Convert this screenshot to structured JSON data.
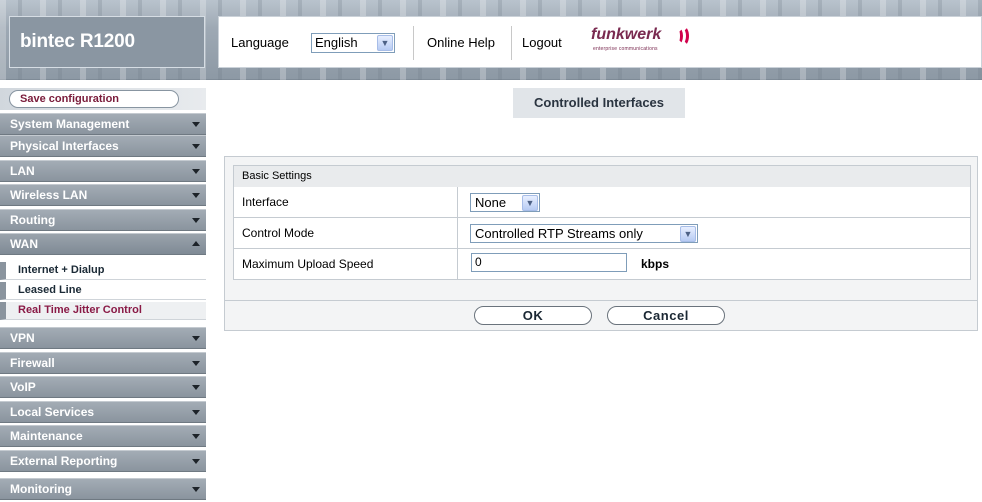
{
  "header": {
    "brand": "bintec R1200",
    "language_label": "Language",
    "language_value": "English",
    "help_label": "Online Help",
    "logout_label": "Logout",
    "logo_word": "funkwerk",
    "logo_tag": "enterprise communications"
  },
  "sidebar": {
    "save_label": "Save configuration",
    "items": [
      {
        "label": "System Management",
        "state": "collapsed"
      },
      {
        "label": "Physical Interfaces",
        "state": "collapsed"
      },
      {
        "label": "LAN",
        "state": "collapsed"
      },
      {
        "label": "Wireless LAN",
        "state": "collapsed"
      },
      {
        "label": "Routing",
        "state": "collapsed"
      },
      {
        "label": "WAN",
        "state": "expanded"
      },
      {
        "label": "VPN",
        "state": "collapsed"
      },
      {
        "label": "Firewall",
        "state": "collapsed"
      },
      {
        "label": "VoIP",
        "state": "collapsed"
      },
      {
        "label": "Local Services",
        "state": "collapsed"
      },
      {
        "label": "Maintenance",
        "state": "collapsed"
      },
      {
        "label": "External Reporting",
        "state": "collapsed"
      },
      {
        "label": "Monitoring",
        "state": "collapsed"
      }
    ],
    "wan_subitems": [
      {
        "label": "Internet + Dialup",
        "active": false
      },
      {
        "label": "Leased Line",
        "active": false
      },
      {
        "label": "Real Time Jitter Control",
        "active": true
      }
    ]
  },
  "main": {
    "page_title": "Controlled Interfaces",
    "section_title": "Basic Settings",
    "fields": {
      "interface_label": "Interface",
      "interface_value": "None",
      "control_mode_label": "Control Mode",
      "control_mode_value": "Controlled RTP Streams only",
      "upload_label": "Maximum Upload Speed",
      "upload_value": "0",
      "upload_unit": "kbps"
    },
    "ok_label": "OK",
    "cancel_label": "Cancel"
  },
  "colors": {
    "active_subitem": "#8a1a46",
    "nav_bg": "#8a949e",
    "logo_accent": "#d1004c"
  }
}
